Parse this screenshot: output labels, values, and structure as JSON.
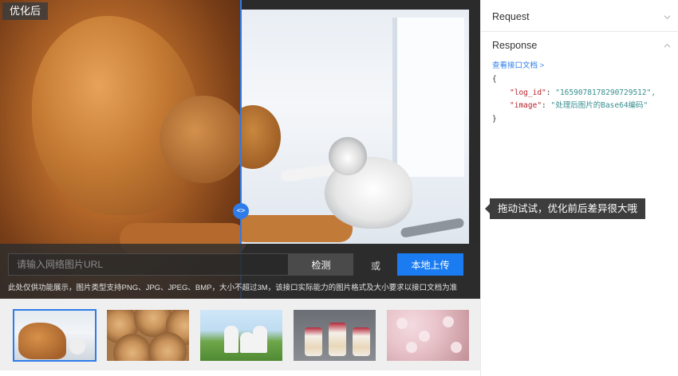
{
  "demo": {
    "badge_label": "优化后",
    "slider_handle_glyph": "<>",
    "url_placeholder": "请输入网络图片URL",
    "detect_label": "检测",
    "or_label": "或",
    "upload_label": "本地上传",
    "notice": "此处仅供功能展示，图片类型支持PNG、JPG、JPEG、BMP，大小不超过3M，该接口实际能力的图片格式及大小要求以接口文档为准"
  },
  "thumbnails": [
    {
      "subject": "dog-and-kitten",
      "selected": true
    },
    {
      "subject": "wood-logs",
      "selected": false
    },
    {
      "subject": "family-on-grass",
      "selected": false
    },
    {
      "subject": "dessert-cups",
      "selected": false
    },
    {
      "subject": "pink-blossoms",
      "selected": false
    }
  ],
  "panel": {
    "request_label": "Request",
    "response_label": "Response",
    "doc_link": "查看接口文档 >",
    "code": {
      "open_brace": "{",
      "log_id_key": "\"log_id\"",
      "log_id_value": "\"1659078178290729512\",",
      "image_key": "\"image\"",
      "image_value": "\"处理后图片的Base64编码\"",
      "close_brace": "}"
    }
  },
  "tooltip": {
    "text": "拖动试试，优化前后差异很大哦"
  },
  "colors": {
    "accent": "#1a7cf0",
    "divider": "#2f7ce8",
    "json_key": "#b5242b",
    "json_value": "#3a8e8f"
  }
}
